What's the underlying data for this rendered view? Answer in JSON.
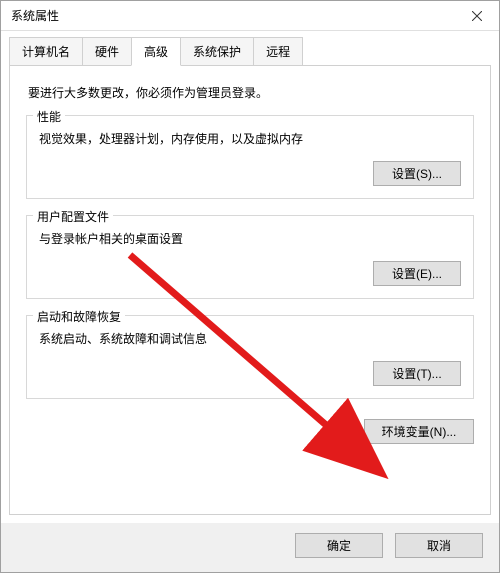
{
  "window": {
    "title": "系统属性"
  },
  "tabs": {
    "computer_name": "计算机名",
    "hardware": "硬件",
    "advanced": "高级",
    "system_protection": "系统保护",
    "remote": "远程"
  },
  "content": {
    "admin_notice": "要进行大多数更改，你必须作为管理员登录。",
    "performance": {
      "title": "性能",
      "desc": "视觉效果，处理器计划，内存使用，以及虚拟内存",
      "settings_btn": "设置(S)..."
    },
    "user_profiles": {
      "title": "用户配置文件",
      "desc": "与登录帐户相关的桌面设置",
      "settings_btn": "设置(E)..."
    },
    "startup_recovery": {
      "title": "启动和故障恢复",
      "desc": "系统启动、系统故障和调试信息",
      "settings_btn": "设置(T)..."
    },
    "env_vars_btn": "环境变量(N)..."
  },
  "footer": {
    "ok": "确定",
    "cancel": "取消"
  }
}
